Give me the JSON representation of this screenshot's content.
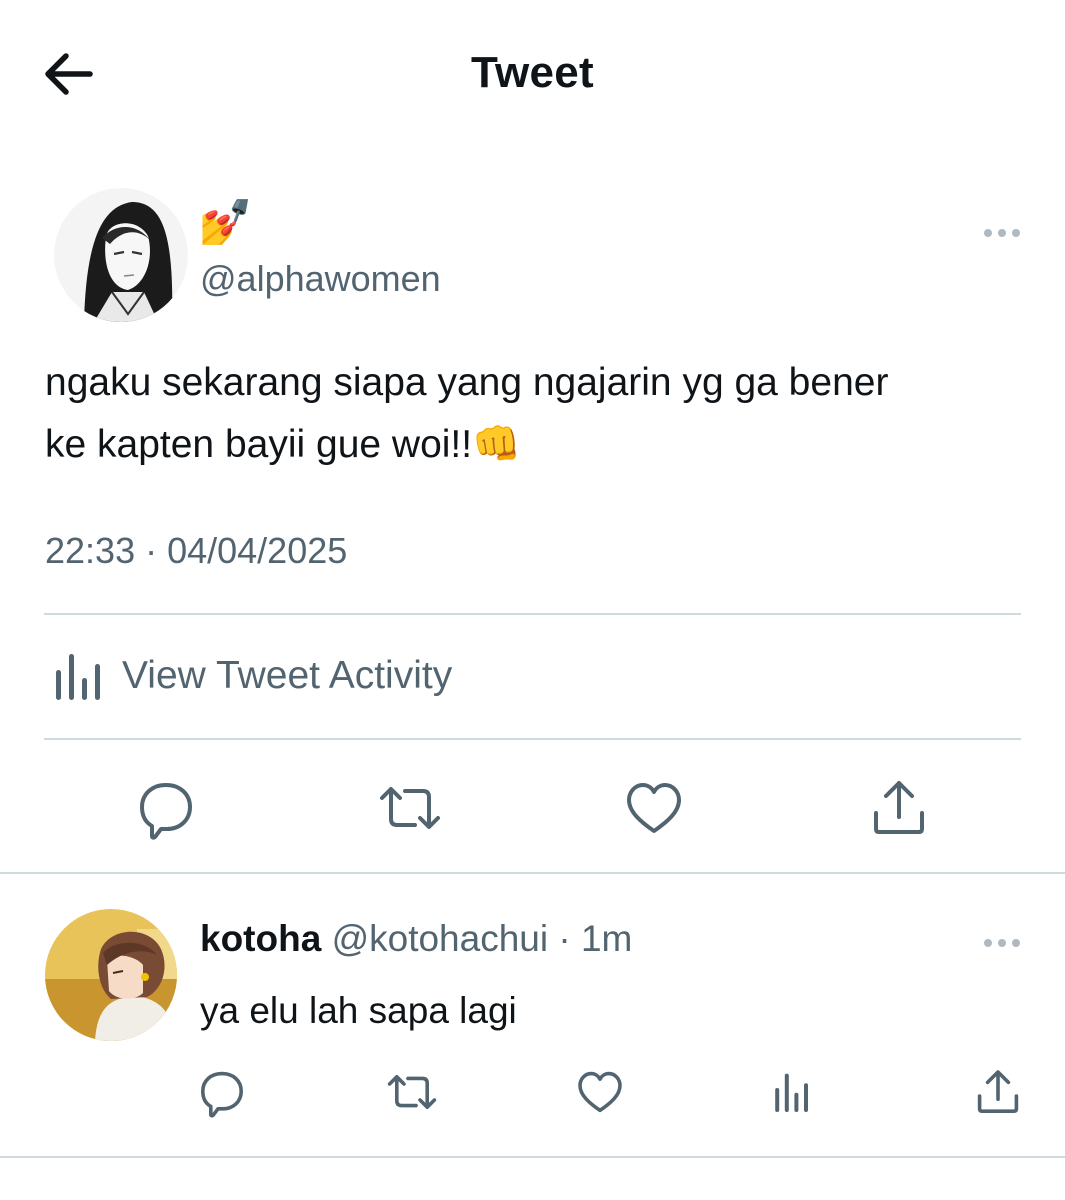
{
  "header": {
    "title": "Tweet",
    "back_icon": "arrow-left-icon"
  },
  "tweet": {
    "display_name": "💅",
    "handle": "@alphawomen",
    "text_line1": "ngaku sekarang siapa yang ngajarin yg ga bener",
    "text_line2": "ke kapten bayii gue woi!!👊",
    "timestamp": "22:33 · 04/04/2025",
    "activity_label": "View Tweet Activity",
    "more_icon": "more-horizontal-icon",
    "actions": [
      "reply-icon",
      "retweet-icon",
      "like-icon",
      "share-icon"
    ]
  },
  "reply": {
    "display_name": "kotoha",
    "handle": "@kotohachui",
    "separator": " · ",
    "time": "1m",
    "text": "ya elu lah sapa lagi",
    "actions": [
      "reply-icon",
      "retweet-icon",
      "like-icon",
      "analytics-icon",
      "share-icon"
    ]
  },
  "colors": {
    "text_primary": "#0f1419",
    "text_secondary": "#536471",
    "divider": "#cfd9de",
    "background": "#ffffff"
  }
}
